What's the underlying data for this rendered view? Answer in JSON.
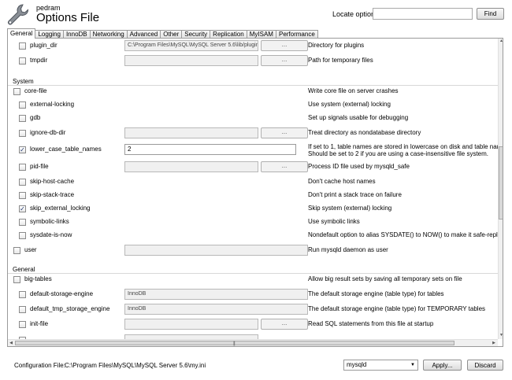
{
  "header": {
    "user": "pedram",
    "title": "Options File",
    "locate_label": "Locate option:",
    "locate_value": "",
    "find_label": "Find"
  },
  "tabs": [
    "General",
    "Logging",
    "InnoDB",
    "Networking",
    "Advanced",
    "Other",
    "Security",
    "Replication",
    "MyISAM",
    "Performance"
  ],
  "active_tab": "General",
  "sections": {
    "system": "System",
    "general": "General"
  },
  "rows": {
    "plugin_dir": {
      "label": "plugin_dir",
      "checked": false,
      "value": "C:\\Program Files\\MySQL\\MySQL Server 5.6\\lib/plugin",
      "browse": "...",
      "desc": "Directory for plugins"
    },
    "tmpdir": {
      "label": "tmpdir",
      "checked": false,
      "value": "",
      "browse": "...",
      "desc": "Path for temporary files"
    },
    "core_file": {
      "label": "core-file",
      "checked": false,
      "desc": "Write core file on server crashes"
    },
    "external_locking": {
      "label": "external-locking",
      "checked": false,
      "desc": "Use system (external) locking"
    },
    "gdb": {
      "label": "gdb",
      "checked": false,
      "desc": "Set up signals usable for debugging"
    },
    "ignore_db_dir": {
      "label": "ignore-db-dir",
      "checked": false,
      "value": "",
      "browse": "...",
      "desc": "Treat directory as nondatabase directory"
    },
    "lower_case_table_names": {
      "label": "lower_case_table_names",
      "checked": true,
      "value": "2",
      "desc_1": "If set to 1, table names are stored in lowercase on disk and table names will be c",
      "desc_2": "Should be set to 2 if you are using a case-insensitive file system."
    },
    "pid_file": {
      "label": "pid-file",
      "checked": false,
      "value": "",
      "browse": "...",
      "desc": "Process ID file used by mysqld_safe"
    },
    "skip_host_cache": {
      "label": "skip-host-cache",
      "checked": false,
      "desc": "Don't cache host names"
    },
    "skip_stack_trace": {
      "label": "skip-stack-trace",
      "checked": false,
      "desc": "Don't print a stack trace on failure"
    },
    "skip_external_locking": {
      "label": "skip_external_locking",
      "checked": true,
      "desc": "Skip system (external) locking"
    },
    "symbolic_links": {
      "label": "symbolic-links",
      "checked": false,
      "desc": "Use symbolic links"
    },
    "sysdate_is_now": {
      "label": "sysdate-is-now",
      "checked": false,
      "desc": "Nondefault option to alias SYSDATE() to NOW() to make it safe-replicable"
    },
    "user": {
      "label": "user",
      "checked": false,
      "value": "",
      "desc": "Run mysqld daemon as user"
    },
    "big_tables": {
      "label": "big-tables",
      "checked": false,
      "desc": "Allow big result sets by saving all temporary sets on file"
    },
    "default_storage_engine": {
      "label": "default-storage-engine",
      "checked": false,
      "value": "InnoDB",
      "desc": "The default storage engine (table type) for tables"
    },
    "default_tmp_storage_engine": {
      "label": "default_tmp_storage_engine",
      "checked": false,
      "value": "InnoDB",
      "desc": "The default storage engine (table type) for TEMPORARY tables"
    },
    "init_file": {
      "label": "init-file",
      "checked": false,
      "value": "",
      "browse": "...",
      "desc": "Read SQL statements from this file at startup"
    }
  },
  "footer": {
    "config_label": "Configuration File:",
    "config_path": "C:\\Program Files\\MySQL\\MySQL Server 5.6\\my.ini",
    "group": "mysqld",
    "apply_label": "Apply...",
    "discard_label": "Discard"
  },
  "icons": {
    "app": "wrench-icon",
    "dropdown": "chevron-down-icon"
  }
}
